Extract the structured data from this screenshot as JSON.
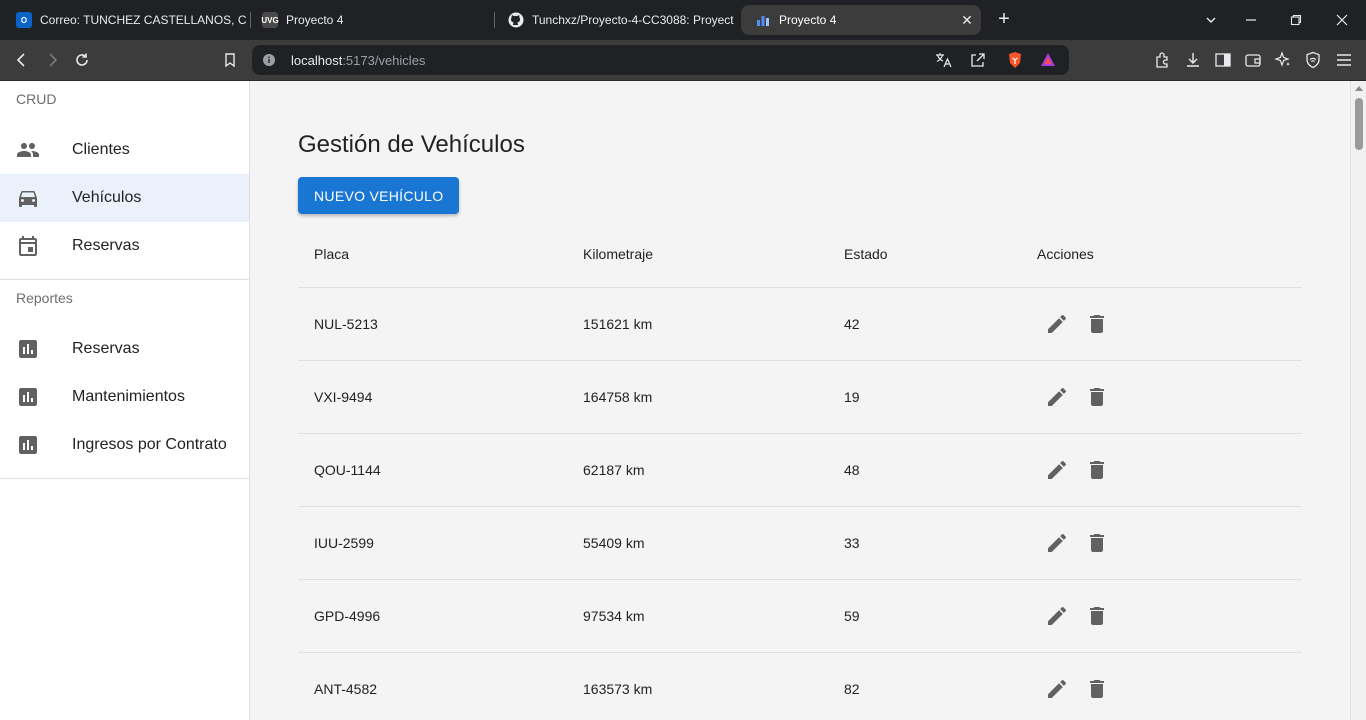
{
  "browser": {
    "tabs": [
      {
        "title": "Correo: TUNCHEZ CASTELLANOS, CR",
        "favicon": "outlook-icon",
        "active": false
      },
      {
        "title": "Proyecto 4",
        "favicon": "uvg-icon",
        "active": false
      },
      {
        "title": "Tunchxz/Proyecto-4-CC3088: Proyect",
        "favicon": "github-icon",
        "active": false
      },
      {
        "title": "Proyecto 4",
        "favicon": "vite-icon",
        "active": true
      }
    ],
    "url_host": "localhost",
    "url_rest": ":5173/vehicles"
  },
  "sidebar": {
    "section_crud": "CRUD",
    "crud_items": [
      {
        "label": "Clientes",
        "icon": "people-icon",
        "active": false
      },
      {
        "label": "Vehículos",
        "icon": "car-icon",
        "active": true
      },
      {
        "label": "Reservas",
        "icon": "calendar-icon",
        "active": false
      }
    ],
    "section_reports": "Reportes",
    "report_items": [
      {
        "label": "Reservas",
        "icon": "bar-chart-icon"
      },
      {
        "label": "Mantenimientos",
        "icon": "bar-chart-icon"
      },
      {
        "label": "Ingresos por Contrato",
        "icon": "bar-chart-icon"
      }
    ]
  },
  "main": {
    "title": "Gestión de Vehículos",
    "new_button": "NUEVO VEHÍCULO",
    "columns": [
      "Placa",
      "Kilometraje",
      "Estado",
      "Acciones"
    ],
    "rows": [
      {
        "placa": "NUL-5213",
        "km": "151621 km",
        "estado": "42"
      },
      {
        "placa": "VXI-9494",
        "km": "164758 km",
        "estado": "19"
      },
      {
        "placa": "QOU-1144",
        "km": "62187 km",
        "estado": "48"
      },
      {
        "placa": "IUU-2599",
        "km": "55409 km",
        "estado": "33"
      },
      {
        "placa": "GPD-4996",
        "km": "97534 km",
        "estado": "59"
      },
      {
        "placa": "ANT-4582",
        "km": "163573 km",
        "estado": "82"
      }
    ],
    "row_actions": [
      "edit-icon",
      "delete-icon"
    ]
  },
  "colors": {
    "primary": "#1976d2",
    "selected_bg": "#eaf1fb",
    "icon_grey": "#616161",
    "chrome_dark": "#202124",
    "chrome_toolbar": "#3c3c3c"
  }
}
